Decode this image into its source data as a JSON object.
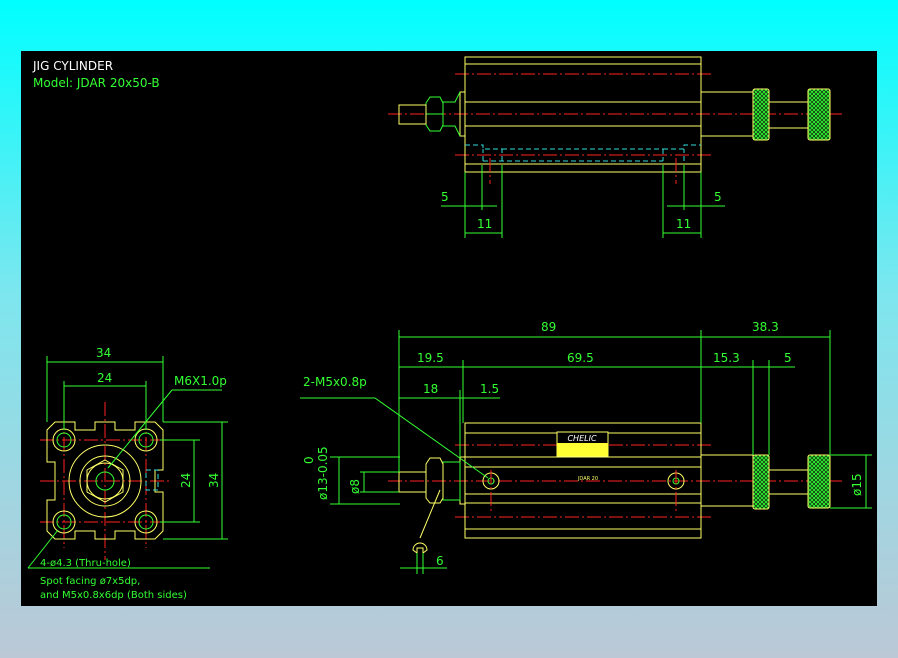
{
  "title": "JIG CYLINDER",
  "model": "Model:  JDAR 20x50-B",
  "colors": {
    "background": "#000000",
    "outline": "#ffff66",
    "dimension": "#33ff33",
    "centerline": "#ff2222",
    "hidden": "#33dddd",
    "title": "#ffffff"
  },
  "top_view": {
    "dims": {
      "left_5": "5",
      "left_11": "11",
      "right_5": "5",
      "right_11": "11"
    }
  },
  "front_view": {
    "dims": {
      "d89": "89",
      "d38_3": "38.3",
      "d19_5": "19.5",
      "d69_5": "69.5",
      "d15_3": "15.3",
      "d5": "5",
      "d18": "18",
      "d1_5": "1.5",
      "d6": "6",
      "dia8": "ø8",
      "dia13": "ø13-0.05",
      "dia13_tol": "0",
      "dia15": "ø15"
    },
    "port_note": "2-M5x0.8p",
    "logo": "CHELIC",
    "body_mark": "JDAR 20"
  },
  "end_view": {
    "dims": {
      "w34": "34",
      "w24": "24",
      "h24": "24",
      "h34": "34"
    },
    "thread_note": "M6X1.0p",
    "hole_note": "4-ø4.3 (Thru-hole)",
    "spot_note_1": "Spot facing ø7x5dp,",
    "spot_note_2": "and M5x0.8x6dp (Both sides)"
  }
}
